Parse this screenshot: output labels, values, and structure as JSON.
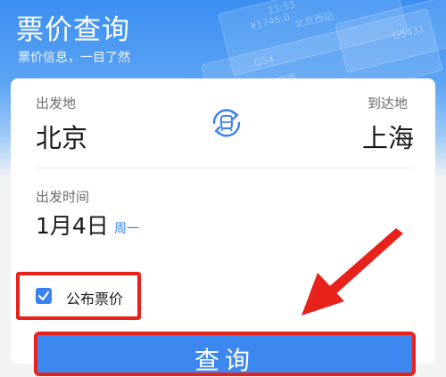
{
  "header": {
    "title": "票价查询",
    "subtitle": "票价信息，一目了然",
    "decor": [
      "北京西站",
      "G54",
      "北京西",
      "¥1746.0",
      "11:55",
      "G5431"
    ]
  },
  "route": {
    "from_label": "出发地",
    "from_city": "北京",
    "to_label": "到达地",
    "to_city": "上海",
    "swap_icon": "train-swap-icon"
  },
  "departure": {
    "label": "出发时间",
    "date": "1月4日",
    "weekday": "周一"
  },
  "options": {
    "public_fare_label": "公布票价",
    "public_fare_checked": true
  },
  "actions": {
    "query_label": "查询"
  },
  "colors": {
    "accent": "#3a82f0",
    "highlight": "#e8221b"
  }
}
